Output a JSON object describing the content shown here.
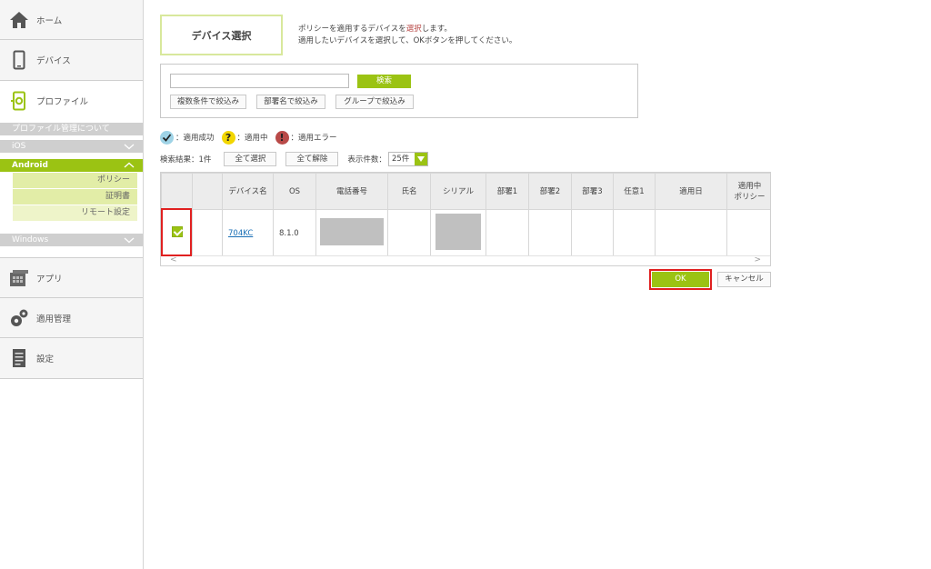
{
  "sidebar": {
    "home": "ホーム",
    "device": "デバイス",
    "profile": "プロファイル",
    "about_profile": "プロファイル管理について",
    "ios": "iOS",
    "android": "Android",
    "android_items": [
      "ポリシー",
      "証明書",
      "リモート設定"
    ],
    "windows": "Windows",
    "app": "アプリ",
    "apply_mgmt": "適用管理",
    "settings": "設定"
  },
  "main": {
    "title": "デバイス選択",
    "intro_line1_pre": "ポリシーを適用するデバイスを",
    "intro_line1_hl": "選択",
    "intro_line1_post": "します。",
    "intro_line2": "適用したいデバイスを選択して、OKボタンを押してください。",
    "search": {
      "placeholder": "",
      "value": "",
      "button": "検索"
    },
    "filters": [
      "複数条件で絞込み",
      "部署名で絞込み",
      "グループで絞込み"
    ],
    "legend": {
      "success": "：適用成功",
      "in_progress": "：適用中",
      "error": "：適用エラー"
    },
    "toolbar": {
      "result_label": "検索結果：1件",
      "select_all": "全て選択",
      "deselect_all": "全て解除",
      "per_page_label": "表示件数：",
      "per_page_value": "25件"
    },
    "table": {
      "headers": [
        "",
        "",
        "デバイス名",
        "OS",
        "電話番号",
        "氏名",
        "シリアル",
        "部署1",
        "部署2",
        "部署3",
        "任意1",
        "適用日",
        "適用中\nポリシー"
      ],
      "rows": [
        {
          "checked": true,
          "device_name": "704KC",
          "os": "8.1.0",
          "phone": "",
          "name": "",
          "serial": "",
          "dept1": "",
          "dept2": "",
          "dept3": "",
          "opt1": "",
          "applied_date": "",
          "applied_policy": ""
        }
      ]
    },
    "ok": "OK",
    "cancel": "キャンセル",
    "colors": {
      "accent": "#9bc313",
      "highlight_frame": "#e02020",
      "success": "#9fd3e6",
      "in_progress": "#f2d600",
      "error": "#b94a48"
    }
  }
}
